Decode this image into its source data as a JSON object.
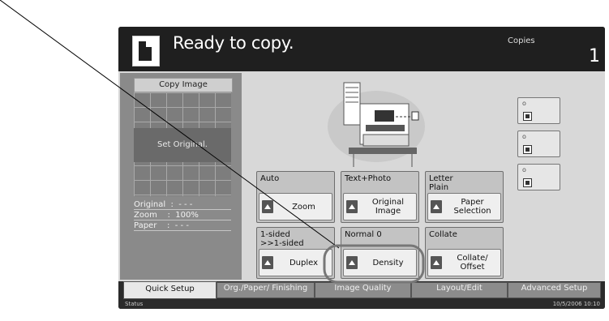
{
  "header": {
    "status": "Ready to copy.",
    "copies_label": "Copies",
    "copies_value": "1"
  },
  "preview": {
    "title": "Copy Image",
    "set_original": "Set Original.",
    "original_line": "Original  :  - - -",
    "zoom_line": "Zoom    :  100%",
    "paper_line": "Paper    :  - - -"
  },
  "functions": [
    {
      "label": "Auto",
      "button": "Zoom"
    },
    {
      "label": "Text+Photo",
      "button": "Original\nImage"
    },
    {
      "label": "Letter\nPlain",
      "button": "Paper\nSelection"
    },
    {
      "label": "1-sided\n>>1-sided",
      "button": "Duplex"
    },
    {
      "label": "Normal 0",
      "button": "Density"
    },
    {
      "label": "Collate",
      "button": "Collate/\nOffset"
    }
  ],
  "tabs": [
    "Quick Setup",
    "Org./Paper/\nFinishing",
    "Image\nQuality",
    "Layout/Edit",
    "Advanced\nSetup"
  ],
  "active_tab": "Quick Setup",
  "status": {
    "left": "Status",
    "right": "10/5/2006    10:10"
  },
  "icons": [
    "document-icon",
    "machine-icon",
    "program-icon",
    "triangle-up-icon"
  ],
  "colors": {
    "panel": "#2b2b2b",
    "body": "#d8d8d8",
    "highlight": "#777777"
  }
}
